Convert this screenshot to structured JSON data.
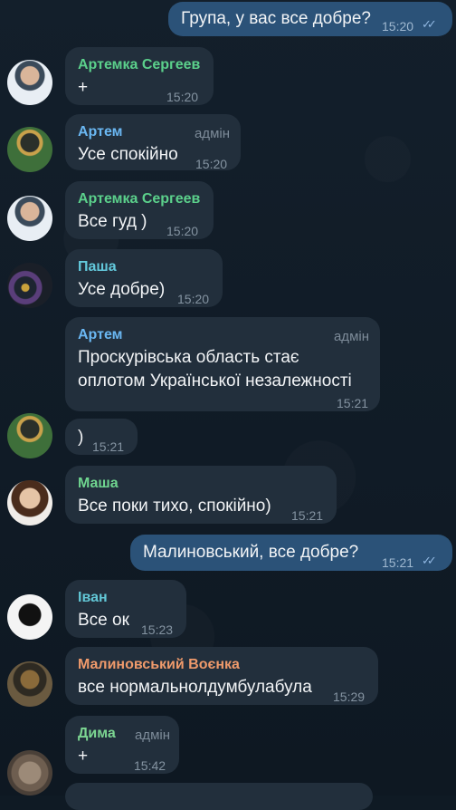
{
  "messages": [
    {
      "text": "Група, у вас все добре?",
      "time": "15:20"
    },
    {
      "sender": "Артемка Сергеев",
      "text": "+",
      "time": "15:20"
    },
    {
      "sender": "Артем",
      "role": "адмін",
      "text": "Усе спокійно",
      "time": "15:20"
    },
    {
      "sender": "Артемка Сергеев",
      "text": "Все гуд )",
      "time": "15:20"
    },
    {
      "sender": "Паша",
      "text": "Усе добре)",
      "time": "15:20"
    },
    {
      "sender": "Артем",
      "role": "адмін",
      "text1": "Проскурівська область стає",
      "text2": "оплотом Української незалежності",
      "time": "15:21"
    },
    {
      "text": ")",
      "time": "15:21"
    },
    {
      "sender": "Маша",
      "text": "Все поки тихо, спокійно)",
      "time": "15:21"
    },
    {
      "text": "Малиновський,  все добре?",
      "time": "15:21"
    },
    {
      "sender": "Іван",
      "text": "Все ок",
      "time": "15:23"
    },
    {
      "sender": "Малиновський Воєнка",
      "text": "все нормальнолдумбулабула",
      "time": "15:29"
    },
    {
      "sender": "Дима",
      "role": "адмін",
      "text": "+",
      "time": "15:42"
    }
  ],
  "colors": {
    "artemka": "#5bd08b",
    "artem": "#6ab7f2",
    "pasha": "#63c9dc",
    "masha": "#6fd58f",
    "ivan": "#62c7d6",
    "malinovsky": "#ef9a6b",
    "dima": "#7cd692"
  },
  "icons": {
    "read": "double-check-icon"
  }
}
